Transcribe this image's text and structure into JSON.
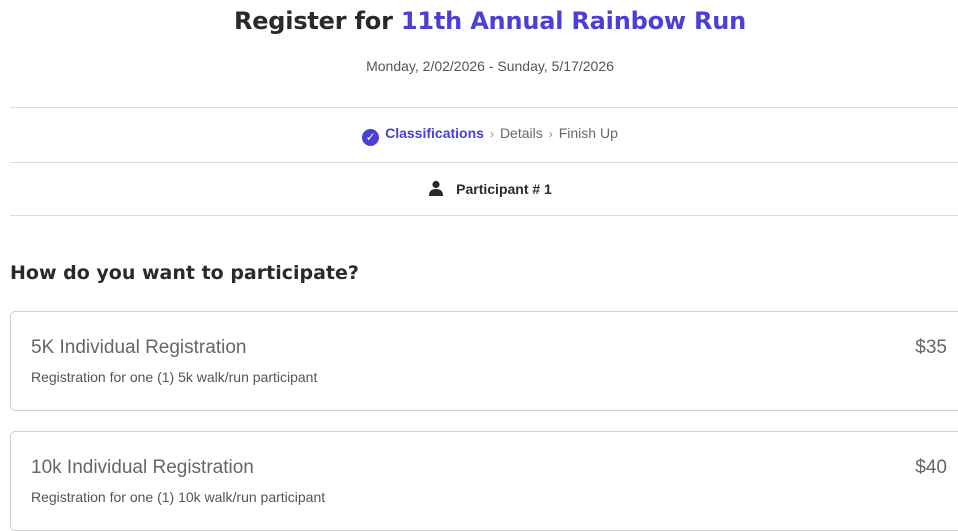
{
  "header": {
    "title_prefix": "Register for ",
    "event_name": "11th Annual Rainbow Run",
    "dates": "Monday, 2/02/2026 - Sunday, 5/17/2026"
  },
  "steps": {
    "items": [
      {
        "label": "Classifications",
        "state": "active"
      },
      {
        "label": "Details",
        "state": "pending"
      },
      {
        "label": "Finish Up",
        "state": "pending"
      }
    ],
    "separator": "›"
  },
  "participant": {
    "label": "Participant # 1",
    "icon": "person-icon"
  },
  "question": "How do you want to participate?",
  "options": [
    {
      "title": "5K Individual Registration",
      "price": "$35",
      "description": "Registration for one (1) 5k walk/run participant"
    },
    {
      "title": "10k Individual Registration",
      "price": "$40",
      "description": "Registration for one (1) 10k walk/run participant"
    }
  ],
  "colors": {
    "accent": "#4b3fd6",
    "border": "#cfcfcf",
    "divider": "#dcdcdc"
  }
}
